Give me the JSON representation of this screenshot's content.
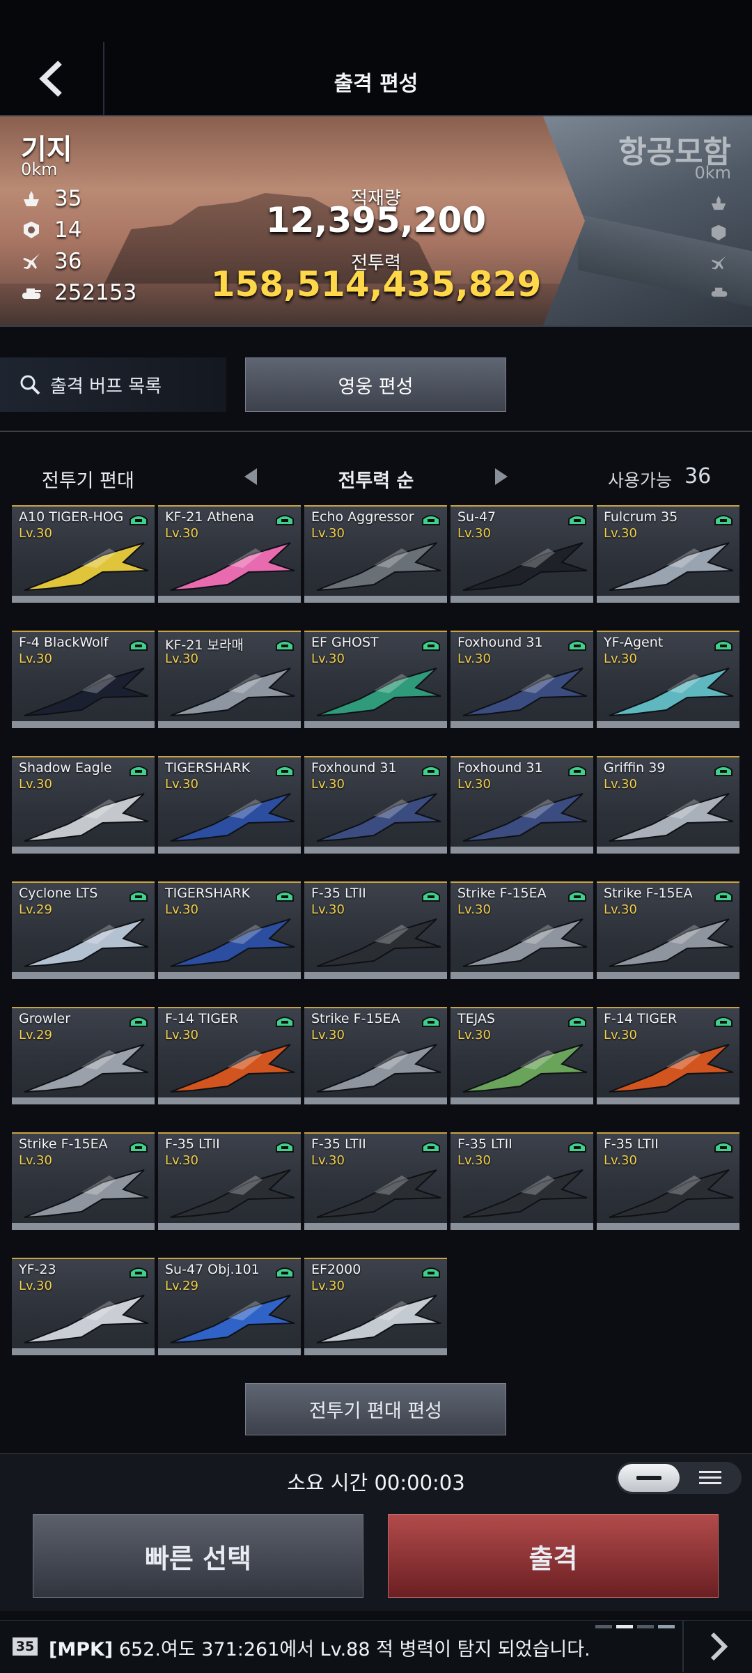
{
  "header": {
    "title": "출격 편성",
    "back_icon": "chevron-left-icon"
  },
  "banner": {
    "base_name": "기지",
    "base_distance": "0km",
    "stats": [
      {
        "icon": "ship-icon",
        "value": "35"
      },
      {
        "icon": "shield-unit-icon",
        "value": "14"
      },
      {
        "icon": "jet-icon",
        "value": "36"
      },
      {
        "icon": "tank-icon",
        "value": "252153"
      }
    ],
    "payload_label": "적재량",
    "payload_value": "12,395,200",
    "combat_label": "전투력",
    "combat_value": "158,514,435,829",
    "carrier_name": "항공모함",
    "carrier_distance": "0km"
  },
  "buff_button": {
    "label": "출격 버프 목록",
    "icon": "search-icon"
  },
  "hero_button": {
    "label": "영웅 편성"
  },
  "filter": {
    "fleet_label": "전투기 편대",
    "sort_label": "전투력 순",
    "avail_label": "사용가능",
    "avail_count": "36"
  },
  "aircraft": [
    {
      "name": "A10 TIGER-HOG",
      "level": "Lv.30",
      "color": "#e0c43a"
    },
    {
      "name": "KF-21 Athena",
      "level": "Lv.30",
      "color": "#e86bb0"
    },
    {
      "name": "Echo Aggressor",
      "level": "Lv.30",
      "color": "#6a7078"
    },
    {
      "name": "Su-47",
      "level": "Lv.30",
      "color": "#1e2228"
    },
    {
      "name": "Fulcrum 35",
      "level": "Lv.30",
      "color": "#9aa3b0"
    },
    {
      "name": "F-4 BlackWolf",
      "level": "Lv.30",
      "color": "#1b2030"
    },
    {
      "name": "KF-21 보라매",
      "level": "Lv.30",
      "color": "#8e96a2"
    },
    {
      "name": "EF GHOST",
      "level": "Lv.30",
      "color": "#2f9b7a"
    },
    {
      "name": "Foxhound 31",
      "level": "Lv.30",
      "color": "#3a4c80"
    },
    {
      "name": "YF-Agent",
      "level": "Lv.30",
      "color": "#5fb8c0"
    },
    {
      "name": "Shadow Eagle",
      "level": "Lv.30",
      "color": "#c4c7cc"
    },
    {
      "name": "TIGERSHARK",
      "level": "Lv.30",
      "color": "#2c4ea0"
    },
    {
      "name": "Foxhound 31",
      "level": "Lv.30",
      "color": "#3a4c80"
    },
    {
      "name": "Foxhound 31",
      "level": "Lv.30",
      "color": "#3a4c80"
    },
    {
      "name": "Griffin 39",
      "level": "Lv.30",
      "color": "#a9b0ba"
    },
    {
      "name": "Cyclone LTS",
      "level": "Lv.29",
      "color": "#b4c1d0"
    },
    {
      "name": "TIGERSHARK",
      "level": "Lv.30",
      "color": "#2c4ea0"
    },
    {
      "name": "F-35 LTII",
      "level": "Lv.30",
      "color": "#2a2e33"
    },
    {
      "name": "Strike F-15EA",
      "level": "Lv.30",
      "color": "#8f959e"
    },
    {
      "name": "Strike F-15EA",
      "level": "Lv.30",
      "color": "#8f959e"
    },
    {
      "name": "Growler",
      "level": "Lv.29",
      "color": "#9aa1aa"
    },
    {
      "name": "F-14 TIGER",
      "level": "Lv.30",
      "color": "#d2541f"
    },
    {
      "name": "Strike F-15EA",
      "level": "Lv.30",
      "color": "#8f959e"
    },
    {
      "name": "TEJAS",
      "level": "Lv.30",
      "color": "#6aa35a"
    },
    {
      "name": "F-14 TIGER",
      "level": "Lv.30",
      "color": "#d2541f"
    },
    {
      "name": "Strike F-15EA",
      "level": "Lv.30",
      "color": "#8f959e"
    },
    {
      "name": "F-35 LTII",
      "level": "Lv.30",
      "color": "#2a2e33"
    },
    {
      "name": "F-35 LTII",
      "level": "Lv.30",
      "color": "#2a2e33"
    },
    {
      "name": "F-35 LTII",
      "level": "Lv.30",
      "color": "#2a2e33"
    },
    {
      "name": "F-35 LTII",
      "level": "Lv.30",
      "color": "#2a2e33"
    },
    {
      "name": "YF-23",
      "level": "Lv.30",
      "color": "#c9ced6"
    },
    {
      "name": "Su-47 Obj.101",
      "level": "Lv.29",
      "color": "#2f63c7"
    },
    {
      "name": "EF2000",
      "level": "Lv.30",
      "color": "#c4cad2"
    }
  ],
  "edit_fleet_button": {
    "label": "전투기 편대 편성"
  },
  "footer": {
    "time_label": "소요 시간 00:00:03",
    "quick_select": "빠른 선택",
    "sortie": "출격",
    "accent_red": "#a23a3c"
  },
  "ticker": {
    "badge": "35",
    "tag": "[MPK]",
    "message": "652.여도  371:261에서 Lv.88 적 병력이 탐지 되었습니다."
  }
}
